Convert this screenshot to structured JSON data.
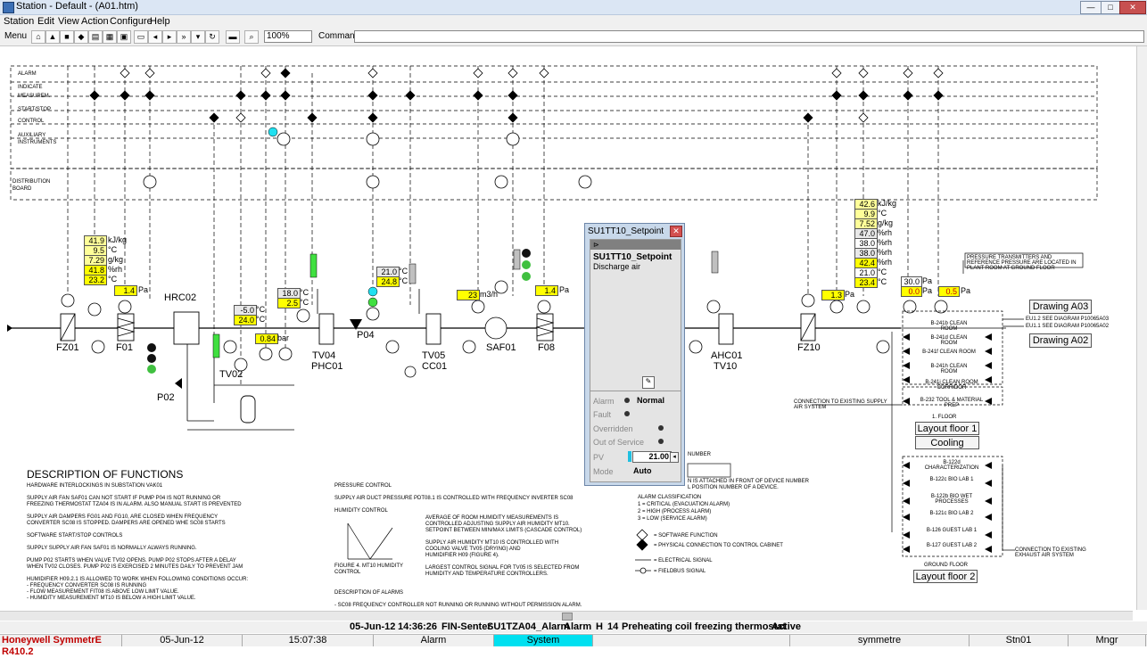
{
  "window": {
    "title": "Station - Default - (A01.htm)",
    "min": "—",
    "max": "□",
    "close": "✕"
  },
  "menu": [
    "Station",
    "Edit",
    "View",
    "Action",
    "Configure",
    "Help"
  ],
  "toolbar": {
    "menu_label": "Menu",
    "zoom": "100%",
    "command_label": "Command",
    "command_value": ""
  },
  "schematic": {
    "rows": [
      "ALARM",
      "INDICATE",
      "MEASUREM.",
      "START/STOP",
      "CONTROL",
      "AUXILIARY INSTRUMENTS"
    ],
    "distribution": "DISTRIBUTION BOARD",
    "units": [
      "FZ01",
      "F01",
      "HRC02",
      "TV02",
      "P02",
      "PHC01",
      "TV04",
      "P04",
      "TV05",
      "CC01",
      "SAF01",
      "F08",
      "AHC01",
      "TV10",
      "FZ10"
    ],
    "values": {
      "v1": "41.9",
      "u1": "kJ/kg",
      "v2": "9.5",
      "u2": "°C",
      "v3": "7.29",
      "u3": "g/kg",
      "v4": "41.8",
      "u4": "%rh",
      "v5": "23.2",
      "u5": "°C",
      "v6": "1.4",
      "u6": "Pa",
      "v7": "-5.0",
      "u7": "°C",
      "v8": "24.0",
      "u8": "°C",
      "v9": "0.84",
      "u9": "bar",
      "v10": "18.0",
      "u10": "°C",
      "v11": "2.5",
      "u11": "°C",
      "v12": "21.0",
      "u12": "°C",
      "v13": "24.8",
      "u13": "°C",
      "v14": "23",
      "u14": "m3/h",
      "v15": "1.4",
      "u15": "Pa",
      "v16": "1.3",
      "u16": "Pa",
      "r1": "42.6",
      "ru1": "kJ/kg",
      "r2": "9.9",
      "ru2": "°C",
      "r3": "7.52",
      "ru3": "g/kg",
      "r4": "47.0",
      "ru4": "%rh",
      "r5": "38.0",
      "ru5": "%rh",
      "r6": "38.0",
      "ru6": "%rh",
      "r7": "42.4",
      "ru7": "%rh",
      "r8": "21.0",
      "ru8": "°C",
      "r9": "23.4",
      "ru9": "°C",
      "p1": "30.0",
      "pu1": "Pa",
      "p2": "0.0",
      "pu2": "Pa",
      "p3": "0.5",
      "pu3": "Pa"
    },
    "rooms": [
      "B-241b CLEAN ROOM",
      "B-241d CLEAN ROOM",
      "B-241f CLEAN ROOM",
      "B-241h CLEAN ROOM",
      "B-241j CLEAN ROOM CORRIDOR",
      "B-232 TOOL & MATERIAL PREP",
      "B-122d CHARACTERIZATION",
      "B-122c BIO LAB 1",
      "B-122b BIO WET PROCESSES",
      "B-121c BIO LAB 2",
      "B-126 GUEST LAB 1",
      "B-127 GUEST LAB 2"
    ],
    "notes": {
      "pressure_note": "PRESSURE TRANSMITTERS AND REFERENCE PRESSURE ARE LOCATED IN PLANT ROOM AT GROUND FLOOR",
      "eu12": "EU1.2 SEE DIAGRAM P10065A03",
      "eu11": "EU1.1 SEE DIAGRAM P10065A02",
      "supply": "CONNECTION TO EXISTING SUPPLY AIR SYSTEM",
      "exhaust": "CONNECTION TO EXISTING EXHAUST AIR SYSTEM",
      "floor1": "1. FLOOR",
      "ground": "GROUND FLOOR"
    },
    "buttons": {
      "drawing_a03": "Drawing A03",
      "drawing_a02": "Drawing A02",
      "layout1": "Layout floor 1",
      "cooling": "Cooling",
      "layout2": "Layout floor 2"
    }
  },
  "description": {
    "title": "DESCRIPTION OF FUNCTIONS",
    "left": "HARDWARE INTERLOCKINGS IN SUBSTATION VAK01\n\nSUPPLY AIR FAN SAF01 CAN NOT START IF PUMP P04 IS NOT RUNNING OR\nFREEZING THERMOSTAT TZA04 IS IN ALARM. ALSO MANUAL START IS PREVENTED\n\nSUPPLY AIR DAMPERS FG01 AND FG10, ARE CLOSED WHEN FREQUENCY\nCONVERTER SC08 IS STOPPED. DAMPERS ARE OPENED WHE SC08 STARTS\n\nSOFTWARE START/STOP CONTROLS\n\nSUPPLY SUPPLY AIR FAN SAF01 IS NORMALLY ALWAYS RUNNING.\n\nPUMP P02 STARTS WHEN VALVE TV02 OPENS. PUMP P02 STOPS AFTER A DELAY\nWHEN TV02 CLOSES. PUMP P02 IS EXERCISED 2 MINUTES DAILY TO PREVENT JAM\n\nHUMIDIFIER H09.2.1 IS ALLOWED TO WORK WHEN FOLLOWING CONDITIONS OCCUR:\n- FREQUENCY CONVERTER SC08 IS RUNNING\n- FLOW MEASUREMENT FIT08 IS ABOVE LOW LIMIT VALUE.\n- HUMIDITY MEASUREMENT MT10 IS BELOW A HIGH LIMIT VALUE.",
    "mid": "PRESSURE CONTROL\n\nSUPPLY AIR DUCT PRESSURE PDT08.1 IS CONTROLLED WITH FREQUENCY INVERTER SC08\n\nHUMIDITY CONTROL",
    "mid2": "AVERAGE OF ROOM HUMIDITY MEASUREMENTS IS\nCONTROLLED ADJUSTING SUPPLY AIR HUMIDITY MT10.\nSETPOINT BETWEEN MIN/MAX LIMITS (CASCADE CONTROL)\n\nSUPPLY AIR HUMIDITY MT10 IS CONTROLLED WITH\nCOOLING VALVE TV05 (DRYING) AND\nHUMIDIFIER H09 (FIGURE 4).\n\nLARGEST CONTROL SIGNAL FOR TV05 IS SELECTED FROM\nHUMIDITY AND TEMPERATURE CONTROLLERS.",
    "fig": "FIGURE 4. MT10 HUMIDITY CONTROL",
    "alarms": "DESCRIPTION OF ALARMS\n\n- SC08 FREQUENCY CONTROLLER NOT RUNNING OR RUNNING WITHOUT PERMISSION ALARM.",
    "right": "N IS ATTACHED IN FRONT OF DEVICE NUMBER\nL POSITION NUMBER OF A DEVICE.",
    "alarm_class": "ALARM CLASSIFICATION\n1 = CRITICAL (EVACUATION ALARM)\n2 = HIGH (PROCESS ALARM)\n3 = LOW (SERVICE ALARM)",
    "legend": [
      "= SOFTWARE FUNCTION",
      "= PHYSICAL CONNECTION TO CONTROL CABINET",
      "= ELECTRICAL SIGNAL",
      "= FIELDBUS SIGNAL"
    ],
    "number_lbl": "NUMBER"
  },
  "popup": {
    "title": "SU1TT10_Setpoint",
    "name": "SU1TT10_Setpoint",
    "desc": "Discharge air",
    "alarm_lbl": "Alarm",
    "alarm_val": "Normal",
    "fault_lbl": "Fault",
    "overridden_lbl": "Overridden",
    "oos_lbl": "Out of Service",
    "pv_lbl": "PV",
    "pv_val": "21.00",
    "mode_lbl": "Mode",
    "mode_val": "Auto"
  },
  "alarm_line": {
    "date": "05-Jun-12",
    "time": "14:36:26",
    "location": "FIN-Senter",
    "tag": "SU1TZA04_Alarm",
    "type": "Alarm",
    "priority": "H",
    "num": "14",
    "text": "Preheating coil freezing thermostat",
    "state": "Active"
  },
  "status": {
    "product": "Honeywell SymmetrE R410.2",
    "date": "05-Jun-12",
    "time": "15:07:38",
    "alarm": "Alarm",
    "system": "System",
    "user": "symmetre",
    "station": "Stn01",
    "level": "Mngr"
  },
  "colors": {
    "product": "#c00000",
    "system_bg": "#00e0f0",
    "value_yellow": "#ffff00"
  }
}
